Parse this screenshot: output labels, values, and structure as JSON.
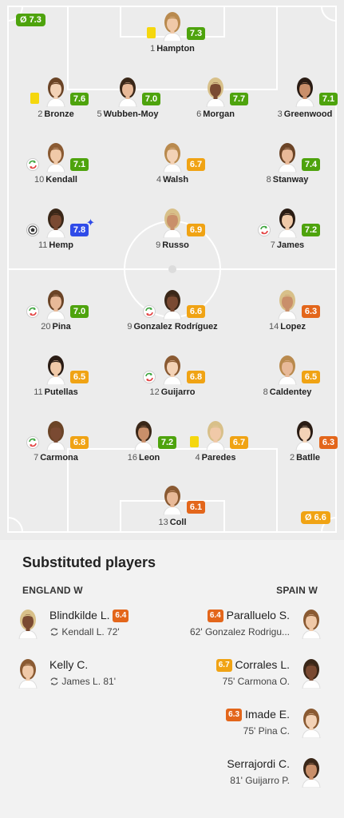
{
  "colors": {
    "green": "#4ea30d",
    "orange": "#f0a314",
    "dark_orange": "#e3661b",
    "blue": "#2f4be8",
    "yellow_card": "#f5d70e"
  },
  "pitch": {
    "team_top_avg": {
      "symbol": "Ø",
      "value": "7.3"
    },
    "team_bottom_avg": {
      "symbol": "Ø",
      "value": "6.6"
    }
  },
  "england": [
    {
      "num": "1",
      "name": "Hampton",
      "rating": "7.3",
      "rating_color": "green",
      "event": "yellow-card"
    },
    {
      "num": "2",
      "name": "Bronze",
      "rating": "7.6",
      "rating_color": "green",
      "event": "yellow-card"
    },
    {
      "num": "5",
      "name": "Wubben-Moy",
      "rating": "7.0",
      "rating_color": "green",
      "event": ""
    },
    {
      "num": "6",
      "name": "Morgan",
      "rating": "7.7",
      "rating_color": "green",
      "event": ""
    },
    {
      "num": "3",
      "name": "Greenwood",
      "rating": "7.1",
      "rating_color": "green",
      "event": ""
    },
    {
      "num": "10",
      "name": "Kendall",
      "rating": "7.1",
      "rating_color": "green",
      "event": "substitution"
    },
    {
      "num": "4",
      "name": "Walsh",
      "rating": "6.7",
      "rating_color": "orange",
      "event": ""
    },
    {
      "num": "8",
      "name": "Stanway",
      "rating": "7.4",
      "rating_color": "green",
      "event": ""
    },
    {
      "num": "11",
      "name": "Hemp",
      "rating": "7.8",
      "rating_color": "blue",
      "event": "ball",
      "star": "✦"
    },
    {
      "num": "9",
      "name": "Russo",
      "rating": "6.9",
      "rating_color": "orange",
      "event": ""
    },
    {
      "num": "7",
      "name": "James",
      "rating": "7.2",
      "rating_color": "green",
      "event": "substitution"
    }
  ],
  "spain": [
    {
      "num": "20",
      "name": "Pina",
      "rating": "7.0",
      "rating_color": "green",
      "event": "substitution"
    },
    {
      "num": "9",
      "name": "Gonzalez Rodríguez",
      "rating": "6.6",
      "rating_color": "orange",
      "event": "substitution"
    },
    {
      "num": "14",
      "name": "Lopez",
      "rating": "6.3",
      "rating_color": "dark_orange",
      "event": ""
    },
    {
      "num": "11",
      "name": "Putellas",
      "rating": "6.5",
      "rating_color": "orange",
      "event": ""
    },
    {
      "num": "12",
      "name": "Guijarro",
      "rating": "6.8",
      "rating_color": "orange",
      "event": "substitution"
    },
    {
      "num": "8",
      "name": "Caldentey",
      "rating": "6.5",
      "rating_color": "orange",
      "event": ""
    },
    {
      "num": "7",
      "name": "Carmona",
      "rating": "6.8",
      "rating_color": "orange",
      "event": "substitution"
    },
    {
      "num": "16",
      "name": "Leon",
      "rating": "7.2",
      "rating_color": "green",
      "event": ""
    },
    {
      "num": "4",
      "name": "Paredes",
      "rating": "6.7",
      "rating_color": "orange",
      "event": "yellow-card"
    },
    {
      "num": "2",
      "name": "Batlle",
      "rating": "6.3",
      "rating_color": "dark_orange",
      "event": ""
    },
    {
      "num": "13",
      "name": "Coll",
      "rating": "6.1",
      "rating_color": "dark_orange",
      "event": ""
    }
  ],
  "substitutes": {
    "title": "Substituted players",
    "home_label": "ENGLAND W",
    "away_label": "SPAIN W",
    "home": [
      {
        "name": "Blindkilde L.",
        "rating": "6.4",
        "rating_color": "dark_orange",
        "replaced": "Kendall L. 72'"
      },
      {
        "name": "Kelly C.",
        "rating": "",
        "rating_color": "",
        "replaced": "James L. 81'"
      }
    ],
    "away": [
      {
        "name": "Paralluelo S.",
        "rating": "6.4",
        "rating_color": "dark_orange",
        "replaced": "62' Gonzalez Rodrigu..."
      },
      {
        "name": "Corrales L.",
        "rating": "6.7",
        "rating_color": "orange",
        "replaced": "75' Carmona O."
      },
      {
        "name": "Imade E.",
        "rating": "6.3",
        "rating_color": "dark_orange",
        "replaced": "75' Pina C."
      },
      {
        "name": "Serrajordi C.",
        "rating": "",
        "rating_color": "",
        "replaced": "81' Guijarro P."
      }
    ]
  }
}
